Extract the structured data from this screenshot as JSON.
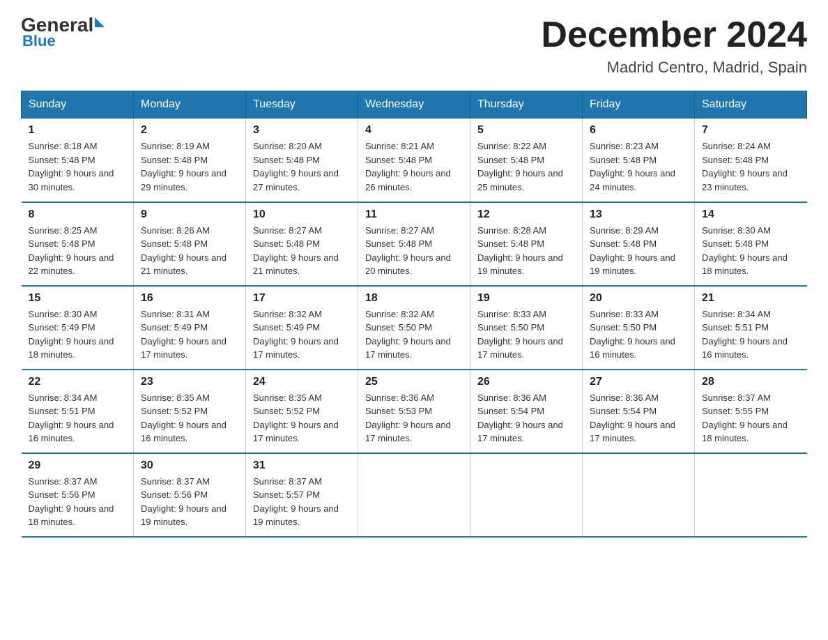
{
  "header": {
    "logo": {
      "general": "General",
      "arrow": "▶",
      "blue": "Blue"
    },
    "title": "December 2024",
    "location": "Madrid Centro, Madrid, Spain"
  },
  "weekdays": [
    "Sunday",
    "Monday",
    "Tuesday",
    "Wednesday",
    "Thursday",
    "Friday",
    "Saturday"
  ],
  "weeks": [
    [
      {
        "day": "1",
        "sunrise": "8:18 AM",
        "sunset": "5:48 PM",
        "daylight": "9 hours and 30 minutes."
      },
      {
        "day": "2",
        "sunrise": "8:19 AM",
        "sunset": "5:48 PM",
        "daylight": "9 hours and 29 minutes."
      },
      {
        "day": "3",
        "sunrise": "8:20 AM",
        "sunset": "5:48 PM",
        "daylight": "9 hours and 27 minutes."
      },
      {
        "day": "4",
        "sunrise": "8:21 AM",
        "sunset": "5:48 PM",
        "daylight": "9 hours and 26 minutes."
      },
      {
        "day": "5",
        "sunrise": "8:22 AM",
        "sunset": "5:48 PM",
        "daylight": "9 hours and 25 minutes."
      },
      {
        "day": "6",
        "sunrise": "8:23 AM",
        "sunset": "5:48 PM",
        "daylight": "9 hours and 24 minutes."
      },
      {
        "day": "7",
        "sunrise": "8:24 AM",
        "sunset": "5:48 PM",
        "daylight": "9 hours and 23 minutes."
      }
    ],
    [
      {
        "day": "8",
        "sunrise": "8:25 AM",
        "sunset": "5:48 PM",
        "daylight": "9 hours and 22 minutes."
      },
      {
        "day": "9",
        "sunrise": "8:26 AM",
        "sunset": "5:48 PM",
        "daylight": "9 hours and 21 minutes."
      },
      {
        "day": "10",
        "sunrise": "8:27 AM",
        "sunset": "5:48 PM",
        "daylight": "9 hours and 21 minutes."
      },
      {
        "day": "11",
        "sunrise": "8:27 AM",
        "sunset": "5:48 PM",
        "daylight": "9 hours and 20 minutes."
      },
      {
        "day": "12",
        "sunrise": "8:28 AM",
        "sunset": "5:48 PM",
        "daylight": "9 hours and 19 minutes."
      },
      {
        "day": "13",
        "sunrise": "8:29 AM",
        "sunset": "5:48 PM",
        "daylight": "9 hours and 19 minutes."
      },
      {
        "day": "14",
        "sunrise": "8:30 AM",
        "sunset": "5:48 PM",
        "daylight": "9 hours and 18 minutes."
      }
    ],
    [
      {
        "day": "15",
        "sunrise": "8:30 AM",
        "sunset": "5:49 PM",
        "daylight": "9 hours and 18 minutes."
      },
      {
        "day": "16",
        "sunrise": "8:31 AM",
        "sunset": "5:49 PM",
        "daylight": "9 hours and 17 minutes."
      },
      {
        "day": "17",
        "sunrise": "8:32 AM",
        "sunset": "5:49 PM",
        "daylight": "9 hours and 17 minutes."
      },
      {
        "day": "18",
        "sunrise": "8:32 AM",
        "sunset": "5:50 PM",
        "daylight": "9 hours and 17 minutes."
      },
      {
        "day": "19",
        "sunrise": "8:33 AM",
        "sunset": "5:50 PM",
        "daylight": "9 hours and 17 minutes."
      },
      {
        "day": "20",
        "sunrise": "8:33 AM",
        "sunset": "5:50 PM",
        "daylight": "9 hours and 16 minutes."
      },
      {
        "day": "21",
        "sunrise": "8:34 AM",
        "sunset": "5:51 PM",
        "daylight": "9 hours and 16 minutes."
      }
    ],
    [
      {
        "day": "22",
        "sunrise": "8:34 AM",
        "sunset": "5:51 PM",
        "daylight": "9 hours and 16 minutes."
      },
      {
        "day": "23",
        "sunrise": "8:35 AM",
        "sunset": "5:52 PM",
        "daylight": "9 hours and 16 minutes."
      },
      {
        "day": "24",
        "sunrise": "8:35 AM",
        "sunset": "5:52 PM",
        "daylight": "9 hours and 17 minutes."
      },
      {
        "day": "25",
        "sunrise": "8:36 AM",
        "sunset": "5:53 PM",
        "daylight": "9 hours and 17 minutes."
      },
      {
        "day": "26",
        "sunrise": "8:36 AM",
        "sunset": "5:54 PM",
        "daylight": "9 hours and 17 minutes."
      },
      {
        "day": "27",
        "sunrise": "8:36 AM",
        "sunset": "5:54 PM",
        "daylight": "9 hours and 17 minutes."
      },
      {
        "day": "28",
        "sunrise": "8:37 AM",
        "sunset": "5:55 PM",
        "daylight": "9 hours and 18 minutes."
      }
    ],
    [
      {
        "day": "29",
        "sunrise": "8:37 AM",
        "sunset": "5:56 PM",
        "daylight": "9 hours and 18 minutes."
      },
      {
        "day": "30",
        "sunrise": "8:37 AM",
        "sunset": "5:56 PM",
        "daylight": "9 hours and 19 minutes."
      },
      {
        "day": "31",
        "sunrise": "8:37 AM",
        "sunset": "5:57 PM",
        "daylight": "9 hours and 19 minutes."
      },
      null,
      null,
      null,
      null
    ]
  ]
}
